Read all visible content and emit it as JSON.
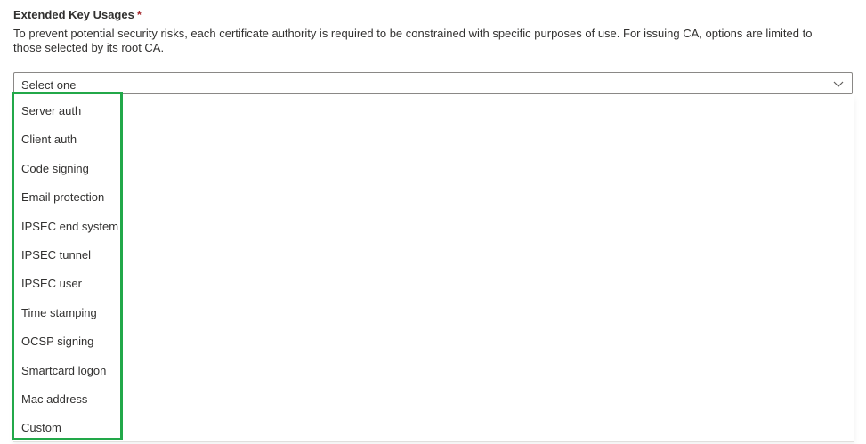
{
  "field": {
    "label": "Extended Key Usages",
    "required_marker": "*",
    "description": "To prevent potential security risks, each certificate authority is required to be constrained with specific purposes of use. For issuing CA, options are limited to those selected by its root CA."
  },
  "select": {
    "selected_value": "Select one",
    "chevron_icon": "chevron-down-icon",
    "options": [
      "Server auth",
      "Client auth",
      "Code signing",
      "Email protection",
      "IPSEC end system",
      "IPSEC tunnel",
      "IPSEC user",
      "Time stamping",
      "OCSP signing",
      "Smartcard logon",
      "Mac address",
      "Custom"
    ]
  },
  "colors": {
    "highlight_border": "#22a849",
    "required_marker": "#a4262c",
    "text": "#323130",
    "select_border": "#8a8886"
  }
}
